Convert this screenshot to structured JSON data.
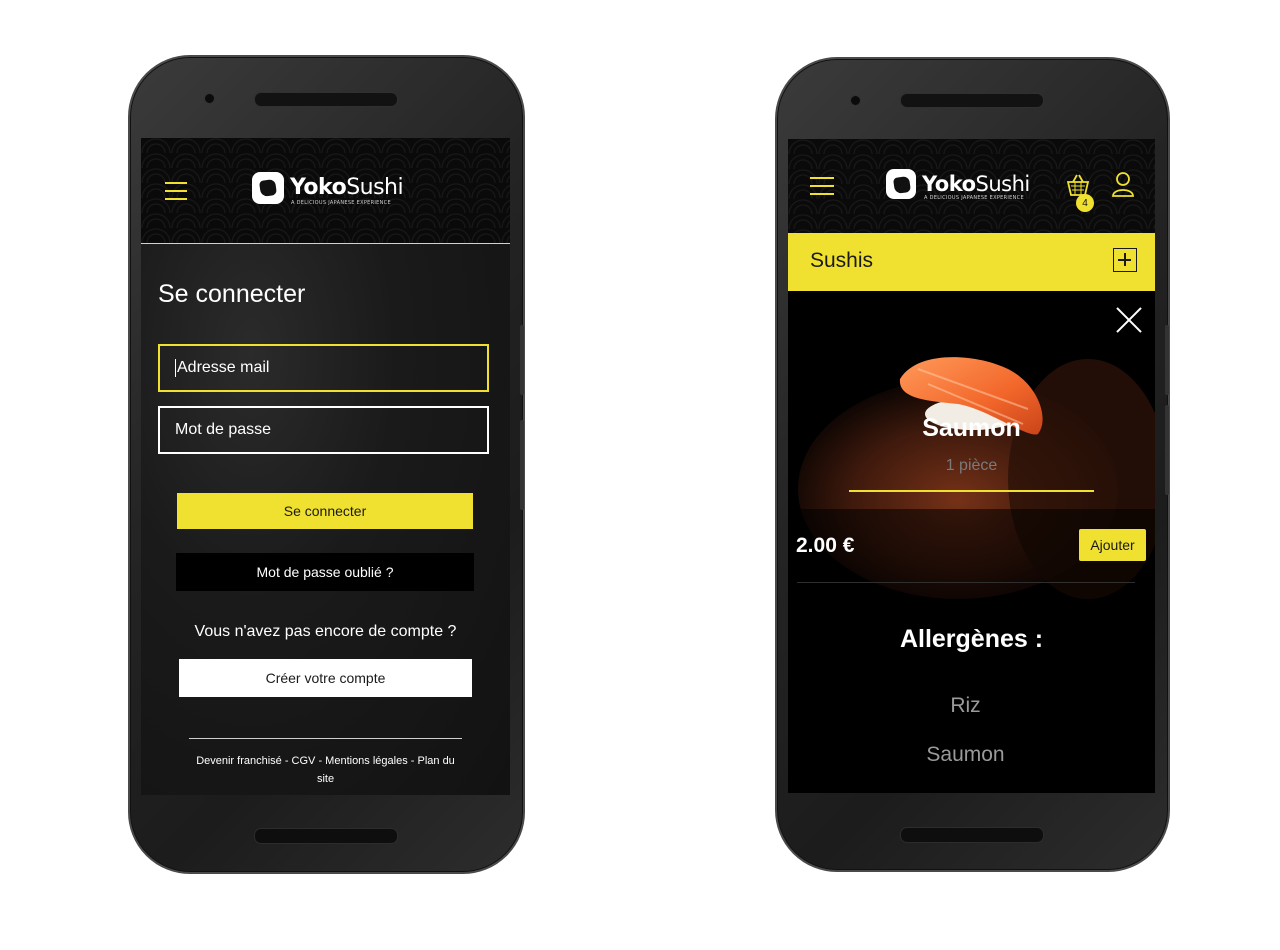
{
  "brand": {
    "name_bold": "Yoko",
    "name_light": "Sushi",
    "tagline": "A DELICIOUS JAPANESE EXPERIENCE"
  },
  "colors": {
    "accent": "#f0e130",
    "background": "#000000",
    "text": "#ffffff"
  },
  "login_screen": {
    "title": "Se connecter",
    "email_placeholder": "Adresse mail",
    "password_placeholder": "Mot de passe",
    "login_button": "Se connecter",
    "forgot_button": "Mot de passe oublié ?",
    "no_account_text": "Vous n'avez pas encore de compte ?",
    "create_account_button": "Créer votre compte",
    "footer_links": "Devenir franchisé - CGV - Mentions légales - Plan du site"
  },
  "product_screen": {
    "cart_count": "4",
    "category_label": "Sushis",
    "product_name": "Saumon",
    "product_pieces": "1 pièce",
    "price": "2.00 €",
    "add_button": "Ajouter",
    "allergens_title": "Allergènes :",
    "allergens": [
      "Riz",
      "Saumon"
    ]
  }
}
